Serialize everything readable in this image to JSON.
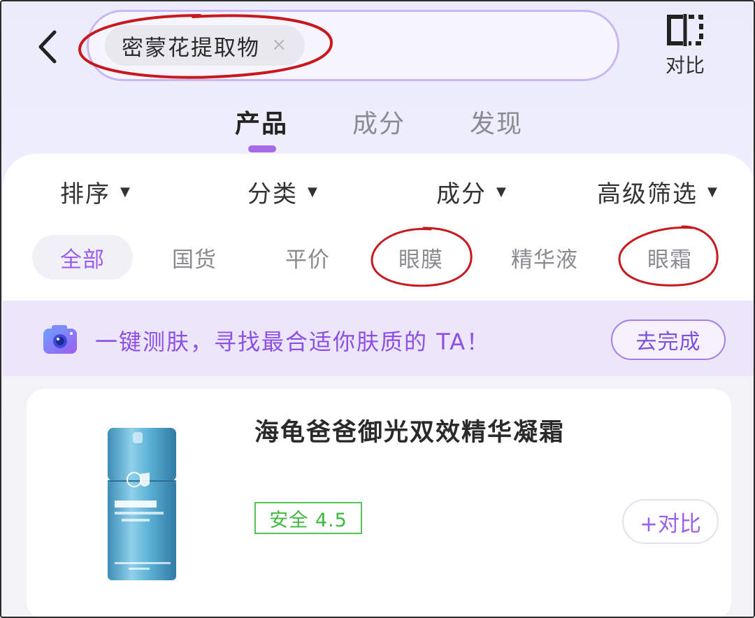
{
  "colors": {
    "accent": "#9a5df0",
    "annotation": "#c8191f",
    "safety": "#3fb83f",
    "banner_bg": "#ebe6f9"
  },
  "header": {
    "back_icon": "chevron-left-icon",
    "search_chip": "密蒙花提取物",
    "search_chip_close": "×",
    "compare_icon": "compare-icon",
    "compare_label": "对比"
  },
  "tabs": [
    {
      "label": "产品",
      "active": true
    },
    {
      "label": "成分",
      "active": false
    },
    {
      "label": "发现",
      "active": false
    }
  ],
  "filters": [
    {
      "label": "排序"
    },
    {
      "label": "分类"
    },
    {
      "label": "成分"
    },
    {
      "label": "高级筛选"
    }
  ],
  "categories": [
    {
      "label": "全部",
      "active": true
    },
    {
      "label": "国货",
      "active": false
    },
    {
      "label": "平价",
      "active": false
    },
    {
      "label": "眼膜",
      "active": false,
      "circled": true
    },
    {
      "label": "精华液",
      "active": false
    },
    {
      "label": "眼霜",
      "active": false,
      "circled": true
    }
  ],
  "banner": {
    "icon": "camera-icon",
    "text": "一键测肤，寻找最合适你肤质的 TA！",
    "button": "去完成"
  },
  "product": {
    "title": "海龟爸爸御光双效精华凝霜",
    "safety_badge": "安全 4.5",
    "compare_button": "+对比",
    "image": "product-bottle-image"
  }
}
